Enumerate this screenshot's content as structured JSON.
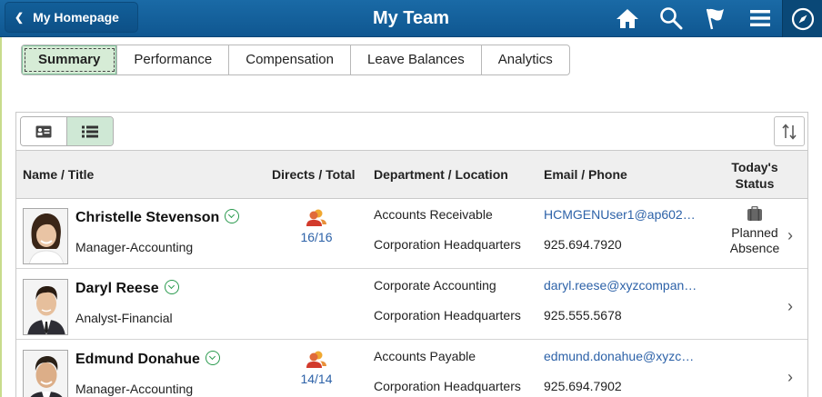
{
  "header": {
    "home_label": "My Homepage",
    "title": "My Team",
    "icons": [
      "home-icon",
      "search-icon",
      "flag-icon",
      "menu-icon",
      "navbar-compass-icon"
    ],
    "bar_color": "#1563a0"
  },
  "tabs": [
    {
      "label": "Summary",
      "active": true
    },
    {
      "label": "Performance",
      "active": false
    },
    {
      "label": "Compensation",
      "active": false
    },
    {
      "label": "Leave Balances",
      "active": false
    },
    {
      "label": "Analytics",
      "active": false
    }
  ],
  "grid": {
    "view_toggle": [
      "card-view-icon",
      "list-view-icon"
    ],
    "active_view": "list",
    "columns": {
      "name": "Name / Title",
      "directs": "Directs / Total",
      "dept": "Department / Location",
      "email": "Email / Phone",
      "status_line1": "Today's",
      "status_line2": "Status"
    },
    "rows": [
      {
        "name": "Christelle Stevenson",
        "title": "Manager-Accounting",
        "directs": "16/16",
        "department": "Accounts Receivable",
        "location": "Corporation Headquarters",
        "email": "HCMGENUser1@ap602…",
        "phone": "925.694.7920",
        "status_line1": "Planned",
        "status_line2": "Absence"
      },
      {
        "name": "Daryl Reese",
        "title": "Analyst-Financial",
        "directs": "",
        "department": "Corporate Accounting",
        "location": "Corporation Headquarters",
        "email": "daryl.reese@xyzcompan…",
        "phone": "925.555.5678",
        "status_line1": "",
        "status_line2": ""
      },
      {
        "name": "Edmund Donahue",
        "title": "Manager-Accounting",
        "directs": "14/14",
        "department": "Accounts Payable",
        "location": "Corporation Headquarters",
        "email": "edmund.donahue@xyzc…",
        "phone": "925.694.7902",
        "status_line1": "",
        "status_line2": ""
      }
    ]
  }
}
